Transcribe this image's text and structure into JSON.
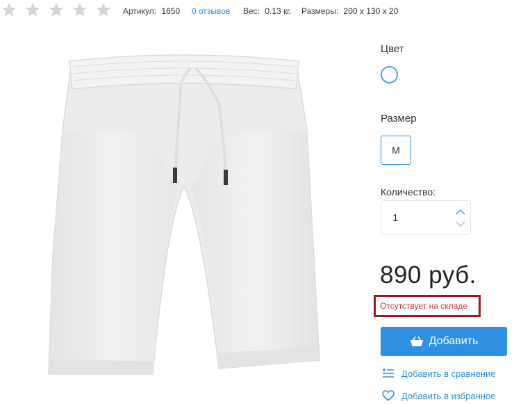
{
  "meta": {
    "rating": {
      "value": 0,
      "max": 5
    },
    "article_label": "Артикул:",
    "article_value": "1650",
    "reviews_link": "0 отзывов",
    "weight_label": "Вес:",
    "weight_value": "0.13 кг.",
    "size_label": "Размеры:",
    "size_value": "200 x 130 x 20"
  },
  "product": {
    "image_icon": "white-shorts-image"
  },
  "options": {
    "color_label": "Цвет",
    "color_value": "#ffffff",
    "size_label": "Размер",
    "size_value": "M",
    "quantity_label": "Количество:",
    "quantity_value": "1"
  },
  "purchase": {
    "price": "890 руб.",
    "stock_status": "Отсутствует на складе",
    "add_button_label": "Добавить",
    "compare_link": "Добавить в сравнение",
    "favorite_link": "Добавить в избранное"
  },
  "colors": {
    "accent": "#2f8fe0",
    "link": "#2f8fd8",
    "stock_border": "#a01818",
    "stock_text": "#d13636",
    "star": "#d4d4d4"
  }
}
